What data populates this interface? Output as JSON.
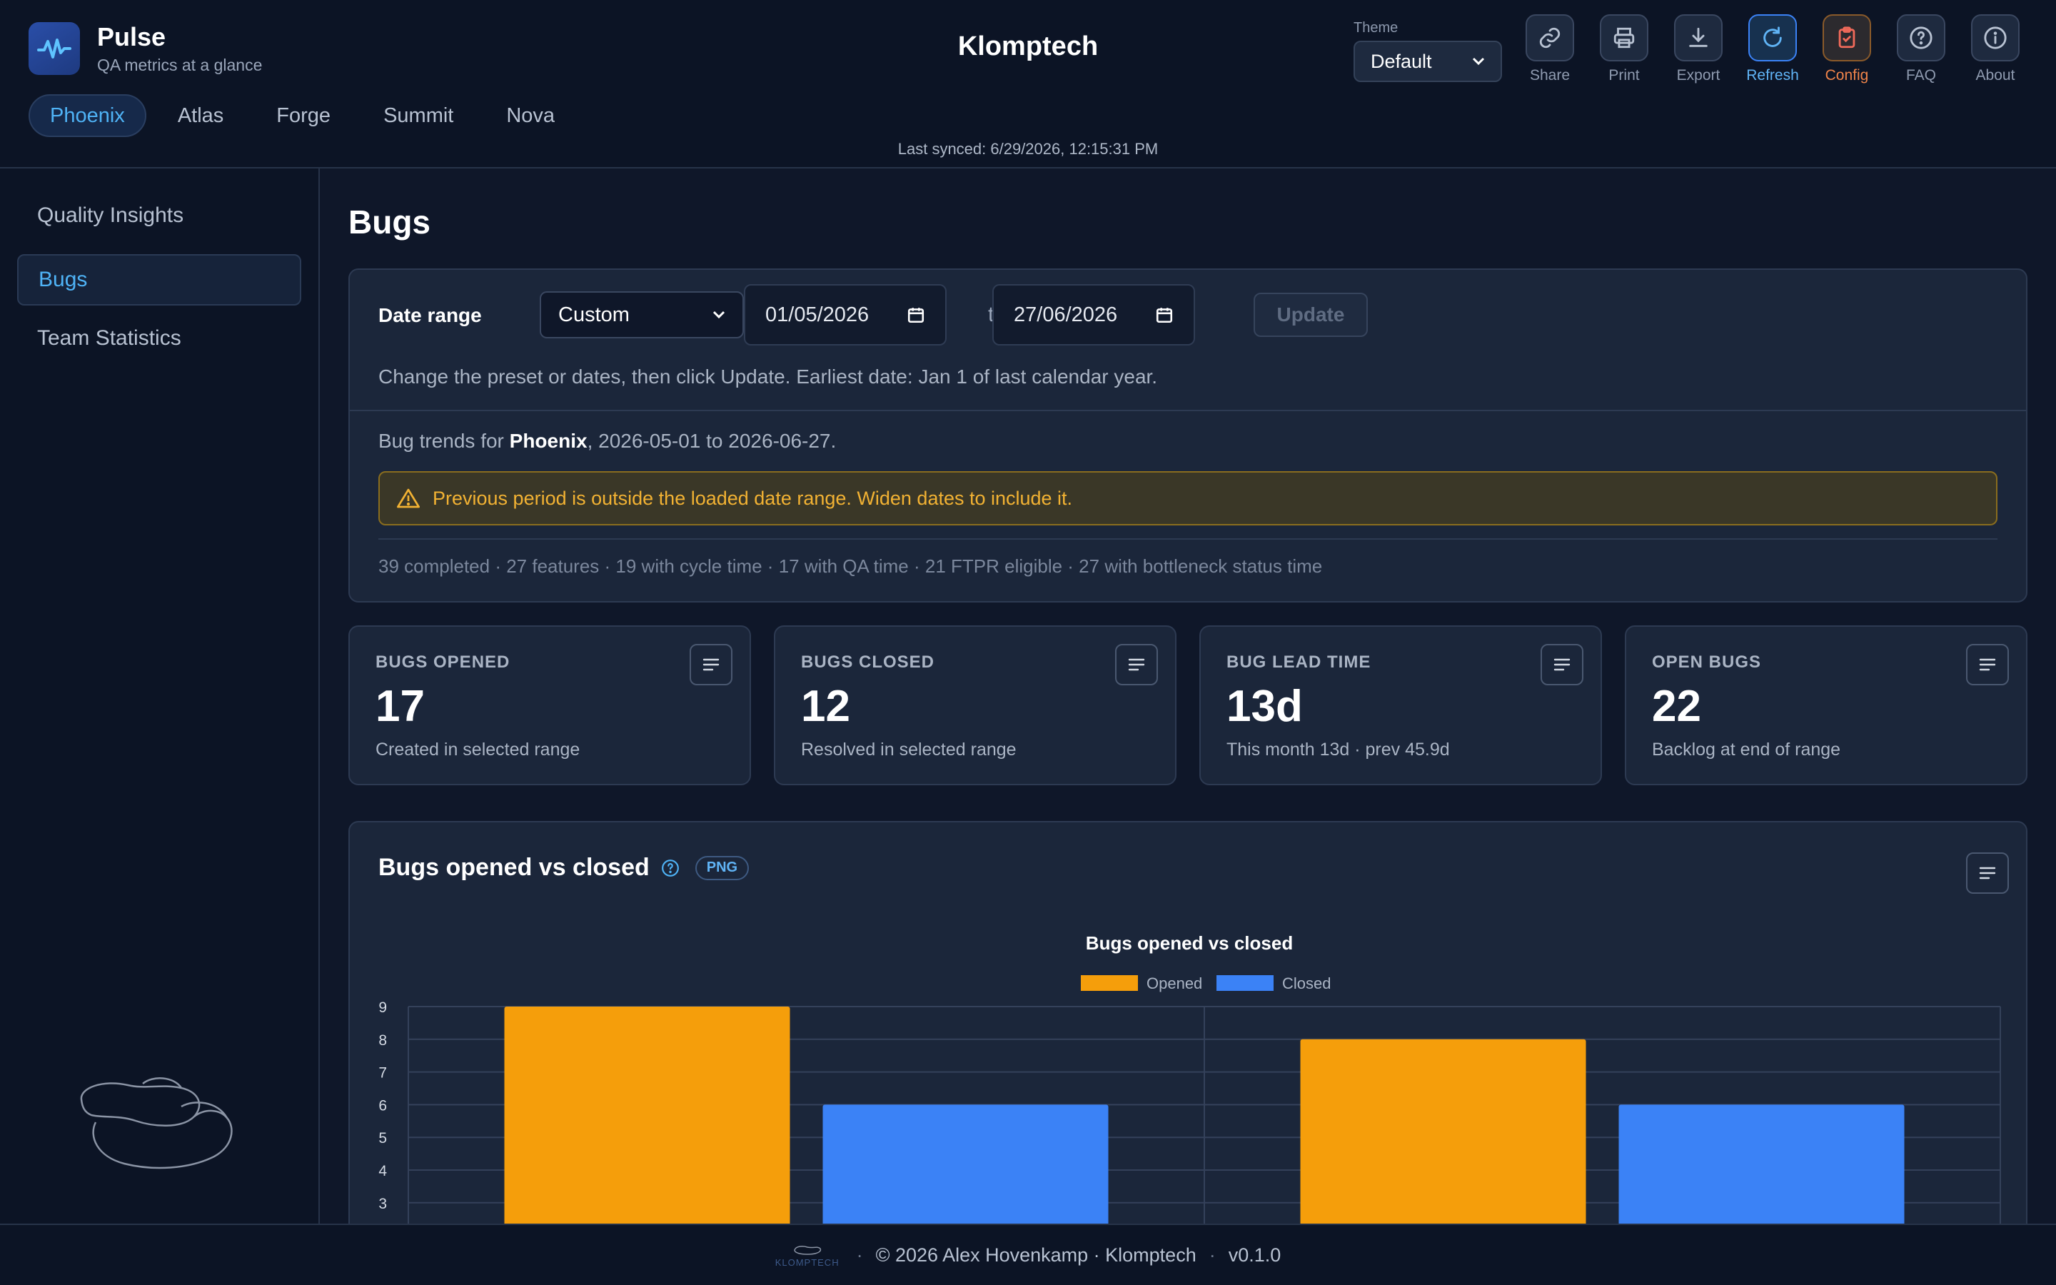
{
  "app": {
    "name": "Pulse",
    "tagline": "QA metrics at a glance",
    "company": "Klomptech",
    "last_synced": "Last synced: 6/29/2026, 12:15:31 PM"
  },
  "theme": {
    "label": "Theme",
    "value": "Default"
  },
  "toolbar": [
    {
      "icon": "link-icon",
      "label": "Share"
    },
    {
      "icon": "printer-icon",
      "label": "Print"
    },
    {
      "icon": "download-icon",
      "label": "Export"
    },
    {
      "icon": "refresh-icon",
      "label": "Refresh"
    },
    {
      "icon": "clipboard-check-icon",
      "label": "Config"
    },
    {
      "icon": "help-circle-icon",
      "label": "FAQ"
    },
    {
      "icon": "info-circle-icon",
      "label": "About"
    }
  ],
  "projects": [
    "Phoenix",
    "Atlas",
    "Forge",
    "Summit",
    "Nova"
  ],
  "active_project": "Phoenix",
  "sidebar": {
    "items": [
      "Quality Insights",
      "Bugs",
      "Team Statistics"
    ],
    "active": "Bugs"
  },
  "page": {
    "title": "Bugs"
  },
  "filters": {
    "label": "Date range",
    "preset": "Custom",
    "from": "01/05/2026",
    "to_label": "to",
    "to": "27/06/2026",
    "update_label": "Update",
    "help": "Change the preset or dates, then click Update. Earliest date: Jan 1 of last calendar year.",
    "trend_prefix": "Bug trends for ",
    "trend_project": "Phoenix",
    "trend_suffix": ", 2026-05-01 to 2026-06-27.",
    "warning": "Previous period is outside the loaded date range. Widen dates to include it.",
    "stats": "39 completed · 27 features · 19 with cycle time · 17 with QA time · 21 FTPR eligible · 27 with bottleneck status time"
  },
  "cards": [
    {
      "title": "BUGS OPENED",
      "value": "17",
      "sub": "Created in selected range"
    },
    {
      "title": "BUGS CLOSED",
      "value": "12",
      "sub": "Resolved in selected range"
    },
    {
      "title": "BUG LEAD TIME",
      "value": "13d",
      "sub": "This month 13d · prev 45.9d"
    },
    {
      "title": "OPEN BUGS",
      "value": "22",
      "sub": "Backlog at end of range"
    }
  ],
  "chart_card": {
    "heading": "Bugs opened vs closed",
    "badge": "PNG"
  },
  "chart_data": {
    "type": "bar",
    "title": "Bugs opened vs closed",
    "categories": [
      "",
      ""
    ],
    "series": [
      {
        "name": "Opened",
        "values": [
          9,
          8
        ],
        "color": "#f59e0b"
      },
      {
        "name": "Closed",
        "values": [
          6,
          6
        ],
        "color": "#3b82f6"
      }
    ],
    "yticks": [
      "3",
      "4",
      "5",
      "6",
      "7",
      "8",
      "9"
    ],
    "ylim": [
      0,
      9
    ],
    "legend": "top-center",
    "grid": true
  },
  "footer": {
    "text": "© 2026 Alex Hovenkamp · Klomptech",
    "version": "v0.1.0",
    "logo_text": "KLOMPTECH"
  }
}
